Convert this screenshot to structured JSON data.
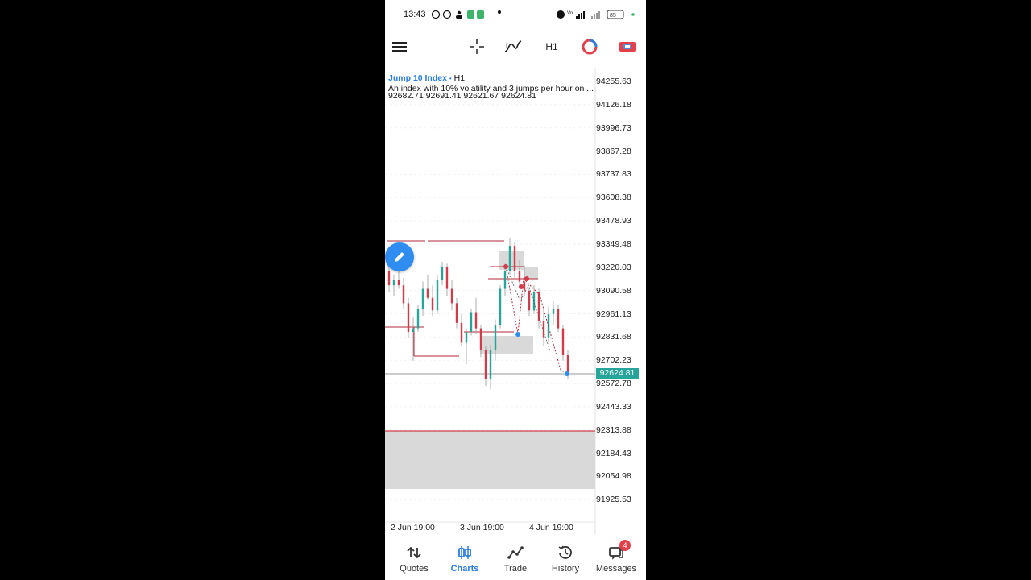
{
  "status_bar": {
    "time": "13:43",
    "battery": "85",
    "icons": [
      "b-icon",
      "whatsapp-icon",
      "person-icon",
      "app-green-icon",
      "chat-green-icon",
      "dot-icon",
      "alarm-icon",
      "volte-icon",
      "signal-icon",
      "wifi-icon",
      "battery-icon"
    ]
  },
  "toolbar": {
    "menu_icon": "hamburger-icon",
    "crosshair_icon": "crosshair-icon",
    "indicators_icon": "indicators-icon",
    "timeframe": "H1",
    "brand_icon": "deriv-logo-icon",
    "trade_icon": "trade-panel-icon"
  },
  "chart_info": {
    "symbol": "Jump 10 Index",
    "separator": "•",
    "timeframe": "H1",
    "description": "An index with 10% volatility and 3 jumps per hour on ...",
    "ohlc": "92682.71 92691.41 92621.67 92624.81"
  },
  "price_axis": [
    "94255.63",
    "94126.18",
    "93996.73",
    "93867.28",
    "93737.83",
    "93608.38",
    "93478.93",
    "93349.48",
    "93220.03",
    "93090.58",
    "92961.13",
    "92831.68",
    "92702.23",
    "92572.78",
    "92443.33",
    "92313.88",
    "92184.43",
    "92054.98",
    "91925.53"
  ],
  "current_price": "92624.81",
  "time_axis": [
    "2 Jun 19:00",
    "3 Jun 19:00",
    "4 Jun 19:00"
  ],
  "colors": {
    "bull": "#26a69a",
    "bear": "#d33b4b",
    "accent": "#2a7de1",
    "zone": "#d9d9d9",
    "line": "#b02a35"
  },
  "chart_data": {
    "type": "candlestick",
    "timeframe": "H1",
    "ylim": [
      91900,
      94300
    ],
    "current_price": 92624.81,
    "last_candle": {
      "open": 92682.71,
      "high": 92691.41,
      "low": 92621.67,
      "close": 92624.81
    },
    "ohlc_approx": [
      [
        93200,
        93240,
        93080,
        93120
      ],
      [
        93120,
        93180,
        93060,
        93150
      ],
      [
        93150,
        93210,
        93100,
        93120
      ],
      [
        93120,
        93160,
        92990,
        93020
      ],
      [
        93020,
        93050,
        92830,
        92860
      ],
      [
        92860,
        92940,
        92700,
        92880
      ],
      [
        92880,
        93010,
        92860,
        92990
      ],
      [
        92990,
        93140,
        92950,
        93100
      ],
      [
        93100,
        93180,
        93040,
        93050
      ],
      [
        93050,
        93120,
        92950,
        92980
      ],
      [
        92980,
        93180,
        92960,
        93150
      ],
      [
        93150,
        93250,
        93120,
        93220
      ],
      [
        93220,
        93240,
        93060,
        93100
      ],
      [
        93100,
        93150,
        92980,
        93020
      ],
      [
        93020,
        93050,
        92880,
        92910
      ],
      [
        92910,
        92960,
        92780,
        92800
      ],
      [
        92800,
        92880,
        92680,
        92860
      ],
      [
        92860,
        92990,
        92840,
        92970
      ],
      [
        92970,
        93050,
        92850,
        92880
      ],
      [
        92880,
        92900,
        92720,
        92760
      ],
      [
        92760,
        92780,
        92560,
        92600
      ],
      [
        92600,
        92790,
        92540,
        92760
      ],
      [
        92760,
        92930,
        92700,
        92900
      ],
      [
        92900,
        93120,
        92880,
        93100
      ],
      [
        93100,
        93240,
        93060,
        93200
      ],
      [
        93200,
        93380,
        93180,
        93340
      ],
      [
        93340,
        93360,
        93160,
        93200
      ],
      [
        93200,
        93260,
        93100,
        93140
      ],
      [
        93140,
        93230,
        93060,
        93090
      ],
      [
        93090,
        93110,
        92950,
        92980
      ],
      [
        92980,
        93120,
        92960,
        93080
      ],
      [
        93080,
        93100,
        92880,
        92920
      ],
      [
        92920,
        92990,
        92780,
        92830
      ],
      [
        92830,
        93000,
        92800,
        92960
      ],
      [
        92960,
        93030,
        92900,
        92990
      ],
      [
        92990,
        93010,
        92860,
        92880
      ],
      [
        92880,
        92900,
        92700,
        92730
      ],
      [
        92730,
        92760,
        92600,
        92624.81
      ]
    ]
  }
}
